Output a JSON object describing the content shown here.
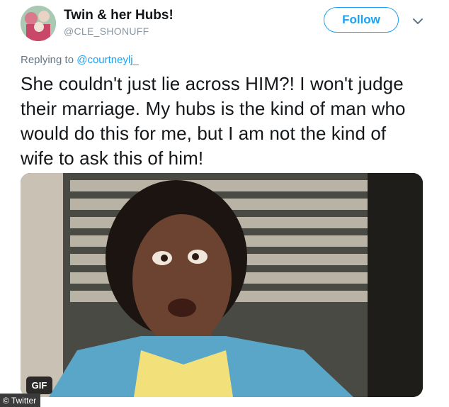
{
  "tweet": {
    "display_name": "Twin & her Hubs!",
    "handle": "@CLE_SHONUFF",
    "follow_label": "Follow",
    "replying_prefix": "Replying to",
    "replying_mention": "@courtneylj_",
    "text": "She couldn't just lie across HIM?! I won't judge their marriage. My hubs is the kind of man who would do this for me, but I am not the kind of wife to ask this of him!",
    "media_badge": "GIF"
  },
  "credit": {
    "label": "Twitter"
  },
  "colors": {
    "accent": "#1da1f2",
    "text": "#14171a",
    "muted": "#657786"
  },
  "icons": {
    "chevron": "chevron-down-icon",
    "credit": "copyright-icon"
  }
}
